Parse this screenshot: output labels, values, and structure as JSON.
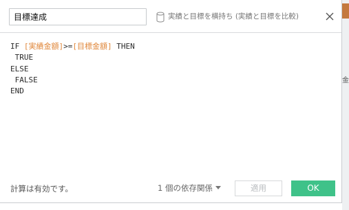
{
  "dialog": {
    "name_value": "目標達成",
    "datasource_label": "実績と目標を横持ち (実績と目標を比較)",
    "icons": {
      "datasource": "database-icon",
      "close": "close-icon"
    }
  },
  "formula": {
    "lines": [
      [
        {
          "text": "IF ",
          "type": "kw"
        },
        {
          "text": "[実績金額]",
          "type": "field"
        },
        {
          "text": ">=",
          "type": "kw"
        },
        {
          "text": "[目標金額]",
          "type": "field"
        },
        {
          "text": " THEN",
          "type": "kw"
        }
      ],
      [
        {
          "text": " TRUE",
          "type": "kw"
        }
      ],
      [
        {
          "text": "ELSE",
          "type": "kw"
        }
      ],
      [
        {
          "text": " FALSE",
          "type": "kw"
        }
      ],
      [
        {
          "text": "END",
          "type": "kw"
        }
      ]
    ]
  },
  "footer": {
    "status": "計算は有効です。",
    "dependencies": "1 個の依存関係",
    "apply_label": "適用",
    "ok_label": "OK"
  },
  "background": {
    "partial_text": "金額"
  },
  "colors": {
    "accent": "#3fc289",
    "field": "#e0873a"
  }
}
